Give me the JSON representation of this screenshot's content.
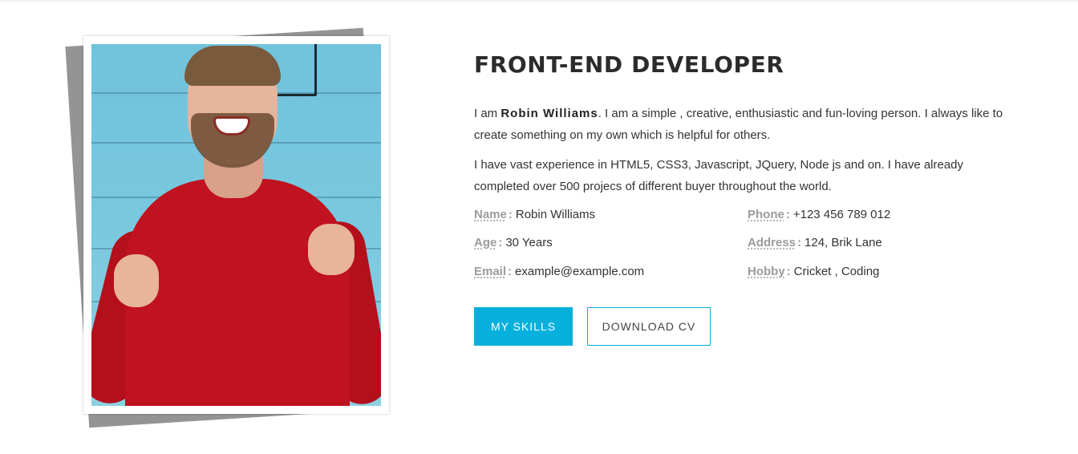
{
  "profile": {
    "title": "FRONT-END DEVELOPER",
    "intro_prefix": "I am ",
    "name": "Robin Williams",
    "intro_suffix": ". I am a simple , creative, enthusiastic and fun-loving person. I always like to create something on my own which is helpful for others.",
    "experience": "I have vast experience in HTML5, CSS3, Javascript, JQuery, Node js and on. I have already completed over 500 projecs of different buyer throughout the world."
  },
  "info": {
    "separator": ":",
    "name": {
      "label": "Name",
      "value": "Robin Williams"
    },
    "age": {
      "label": "Age",
      "value": "30 Years"
    },
    "email": {
      "label": "Email",
      "value": "example@example.com"
    },
    "phone": {
      "label": "Phone",
      "value": "+123 456 789 012"
    },
    "address": {
      "label": "Address",
      "value": "124, Brik Lane"
    },
    "hobby": {
      "label": "Hobby",
      "value": "Cricket , Coding"
    }
  },
  "buttons": {
    "skills": "MY SKILLS",
    "download": "DOWNLOAD CV"
  },
  "colors": {
    "accent": "#06b0dd",
    "label": "#9b9b9b",
    "shadow_card": "#949494"
  }
}
